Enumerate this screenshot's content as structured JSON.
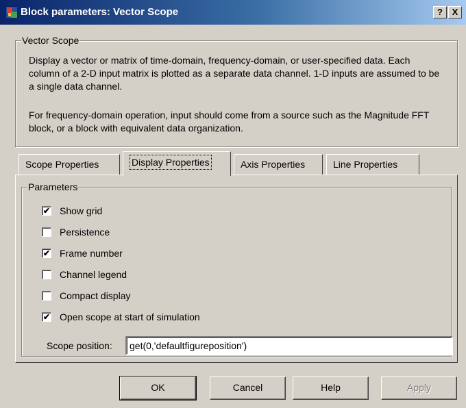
{
  "window": {
    "title": "Block parameters: Vector Scope",
    "help_label": "?",
    "close_label": "X"
  },
  "description": {
    "group_label": "Vector Scope",
    "paragraph1": "Display a vector or matrix of time-domain, frequency-domain, or user-specified data. Each column of a 2-D input matrix is plotted as a separate data channel.  1-D inputs are assumed to be a single data channel.",
    "paragraph2": "For frequency-domain operation, input should come from a source such as the Magnitude FFT block, or a block with equivalent data organization."
  },
  "tabs": [
    {
      "label": "Scope Properties",
      "active": false
    },
    {
      "label": "Display Properties",
      "active": true
    },
    {
      "label": "Axis Properties",
      "active": false
    },
    {
      "label": "Line Properties",
      "active": false
    }
  ],
  "parameters": {
    "group_label": "Parameters",
    "checkboxes": [
      {
        "label": "Show grid",
        "checked": true
      },
      {
        "label": "Persistence",
        "checked": false
      },
      {
        "label": "Frame number",
        "checked": true
      },
      {
        "label": "Channel legend",
        "checked": false
      },
      {
        "label": "Compact display",
        "checked": false
      },
      {
        "label": "Open scope at start of simulation",
        "checked": true
      }
    ],
    "scope_position_label": "Scope position:",
    "scope_position_value": "get(0,'defaultfigureposition')"
  },
  "buttons": {
    "ok": "OK",
    "cancel": "Cancel",
    "help": "Help",
    "apply": "Apply"
  },
  "check_mark": "✔"
}
